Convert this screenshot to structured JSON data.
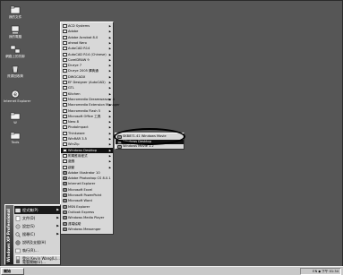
{
  "desktop": {
    "icons": [
      {
        "label": "我的文件",
        "icon": "documents-folder-icon"
      },
      {
        "label": "我的電腦",
        "icon": "computer-icon"
      },
      {
        "label": "網路上的芳鄰",
        "icon": "network-icon"
      },
      {
        "label": "資源回收筒",
        "icon": "recycle-bin-icon"
      },
      {
        "label": "Internet Explorer",
        "icon": "ie-icon"
      },
      {
        "label": "W",
        "icon": "folder-icon"
      },
      {
        "label": "Tools",
        "icon": "folder-icon"
      }
    ]
  },
  "start_menu": {
    "band_text": "Windows XP Professional",
    "items": [
      {
        "label": "程式集(P)",
        "has_submenu": true,
        "icon": "programs-icon"
      },
      {
        "label": "文件(D)",
        "has_submenu": true,
        "icon": "documents-icon"
      },
      {
        "label": "設定(S)",
        "has_submenu": true,
        "icon": "settings-icon"
      },
      {
        "label": "搜尋(C)",
        "has_submenu": true,
        "icon": "search-icon"
      },
      {
        "label": "說明及支援(H)",
        "has_submenu": false,
        "icon": "help-icon"
      },
      {
        "label": "執行(R)...",
        "has_submenu": false,
        "icon": "run-icon"
      },
      {
        "label": "登出 Kevin Wang(L)...",
        "has_submenu": false,
        "icon": "logoff-icon"
      },
      {
        "label": "電腦關機(U)...",
        "has_submenu": false,
        "icon": "shutdown-icon"
      }
    ]
  },
  "programs_menu": {
    "items": [
      {
        "label": "ACD Systems",
        "submenu": true,
        "kind": "folder"
      },
      {
        "label": "Adobe",
        "submenu": true,
        "kind": "folder"
      },
      {
        "label": "Adobe Acrobat 8.0",
        "submenu": true,
        "kind": "folder"
      },
      {
        "label": "ahead Nero",
        "submenu": true,
        "kind": "folder"
      },
      {
        "label": "AutoCAD R14",
        "submenu": true,
        "kind": "folder"
      },
      {
        "label": "AutoCAD R14 (Chinese)",
        "submenu": true,
        "kind": "folder"
      },
      {
        "label": "CorelDRAW 9",
        "submenu": true,
        "kind": "folder"
      },
      {
        "label": "Dr.eye 7",
        "submenu": true,
        "kind": "folder"
      },
      {
        "label": "Dr.eye 2005 譯典通",
        "submenu": true,
        "kind": "folder"
      },
      {
        "label": "DWGCADX",
        "submenu": true,
        "kind": "folder"
      },
      {
        "label": "EF Designer (AutoCAD)",
        "submenu": true,
        "kind": "folder"
      },
      {
        "label": "GTL",
        "submenu": true,
        "kind": "folder"
      },
      {
        "label": "Kitchen",
        "submenu": true,
        "kind": "folder"
      },
      {
        "label": "Macromedia Dreamweaver 4",
        "submenu": true,
        "kind": "folder"
      },
      {
        "label": "Macromedia Extension Manager",
        "submenu": true,
        "kind": "folder"
      },
      {
        "label": "Macromedia Flash 5",
        "submenu": true,
        "kind": "folder"
      },
      {
        "label": "Microsoft Office 工具",
        "submenu": true,
        "kind": "folder"
      },
      {
        "label": "Nero 8",
        "submenu": true,
        "kind": "folder"
      },
      {
        "label": "PhotoImpact",
        "submenu": true,
        "kind": "folder"
      },
      {
        "label": "Thinkware",
        "submenu": true,
        "kind": "folder"
      },
      {
        "label": "WinRAR 3.5",
        "submenu": true,
        "kind": "folder"
      },
      {
        "label": "WinZip",
        "submenu": true,
        "kind": "folder"
      },
      {
        "label": "Windows Desktop",
        "submenu": true,
        "kind": "folder",
        "selected": true
      },
      {
        "label": "附屬應用程式",
        "submenu": true,
        "kind": "folder"
      },
      {
        "label": "遊戲",
        "submenu": true,
        "kind": "folder"
      },
      {
        "label": "啟動",
        "submenu": true,
        "kind": "folder"
      },
      {
        "label": "Adobe Illustrator 10",
        "submenu": false,
        "kind": "app"
      },
      {
        "label": "Adobe Photoshop CS 8.0.1",
        "submenu": false,
        "kind": "app"
      },
      {
        "label": "Internet Explorer",
        "submenu": false,
        "kind": "app"
      },
      {
        "label": "Microsoft Excel",
        "submenu": false,
        "kind": "app"
      },
      {
        "label": "Microsoft PowerPoint",
        "submenu": false,
        "kind": "app"
      },
      {
        "label": "Microsoft Word",
        "submenu": false,
        "kind": "app"
      },
      {
        "label": "MSN Explorer",
        "submenu": false,
        "kind": "app"
      },
      {
        "label": "Outlook Express",
        "submenu": false,
        "kind": "app"
      },
      {
        "label": "Windows Media Player",
        "submenu": false,
        "kind": "app"
      },
      {
        "label": "遠端協助",
        "submenu": false,
        "kind": "app"
      },
      {
        "label": "Windows Messenger",
        "submenu": false,
        "kind": "app"
      }
    ]
  },
  "desktop_submenu": {
    "items": [
      {
        "label": "SKB871.41 Windows Movie",
        "kind": "app"
      },
      {
        "label": "Windows Desktop",
        "kind": "app",
        "selected": true
      },
      {
        "label": "Windows Movie 1.2",
        "kind": "app"
      }
    ]
  },
  "taskbar": {
    "start_label": "開始",
    "tray_text": "EN ◆ 下午 01:34"
  }
}
